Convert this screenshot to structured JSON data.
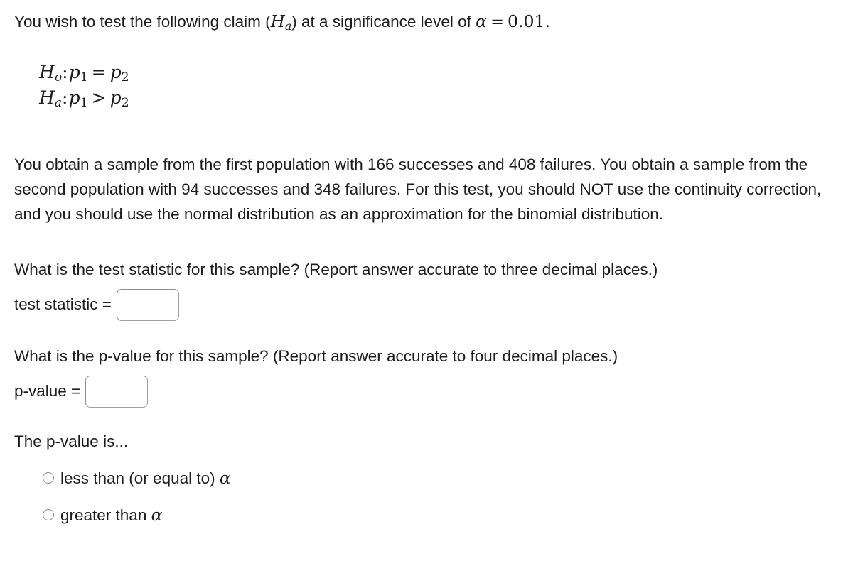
{
  "question": {
    "intro": {
      "text_before_symbol": "You wish to test the following claim (",
      "claim_symbol_H": "H",
      "claim_symbol_sub": "a",
      "text_after_symbol": ") at a significance level of ",
      "alpha_symbol": "α",
      "equals": "=",
      "alpha_value": "0.01",
      "period": "."
    },
    "hypotheses": [
      {
        "name": "null-hypothesis",
        "label_H": "H",
        "label_sub": "o",
        "colon": ":",
        "left_p": "p",
        "left_sub": "1",
        "operator": "=",
        "right_p": "p",
        "right_sub": "2"
      },
      {
        "name": "alternative-hypothesis",
        "label_H": "H",
        "label_sub": "a",
        "colon": ":",
        "left_p": "p",
        "left_sub": "1",
        "operator": ">",
        "right_p": "p",
        "right_sub": "2"
      }
    ],
    "body_paragraph": "You obtain a sample from the first population with 166 successes and 408 failures. You obtain a sample from the second population with 94 successes and 348 failures. For this test, you should NOT use the continuity correction, and you should use the normal distribution as an approximation for the binomial distribution.",
    "sample_data": {
      "population_1_successes": 166,
      "population_1_failures": 408,
      "population_2_successes": 94,
      "population_2_failures": 348,
      "significance_level": 0.01,
      "continuity_correction": false
    }
  },
  "test_statistic": {
    "prompt": "What is the test statistic for this sample? (Report answer accurate to three decimal places.)",
    "label": "test statistic =",
    "value": "",
    "placeholder": ""
  },
  "p_value": {
    "prompt": "What is the p-value for this sample? (Report answer accurate to four decimal places.)",
    "label": "p-value =",
    "value": "",
    "placeholder": ""
  },
  "p_value_comparison": {
    "heading": "The p-value is...",
    "options": [
      {
        "id": "less-than-alpha",
        "text_before": "less than (or equal to) ",
        "alpha_symbol": "α",
        "selected": false
      },
      {
        "id": "greater-than-alpha",
        "text_before": "greater than ",
        "alpha_symbol": "α",
        "selected": false
      }
    ]
  },
  "colors": {
    "background": "#ffffff",
    "text": "#1c1c1c",
    "input_border": "#a0a0a0",
    "radio_border": "#8d8d8d"
  }
}
